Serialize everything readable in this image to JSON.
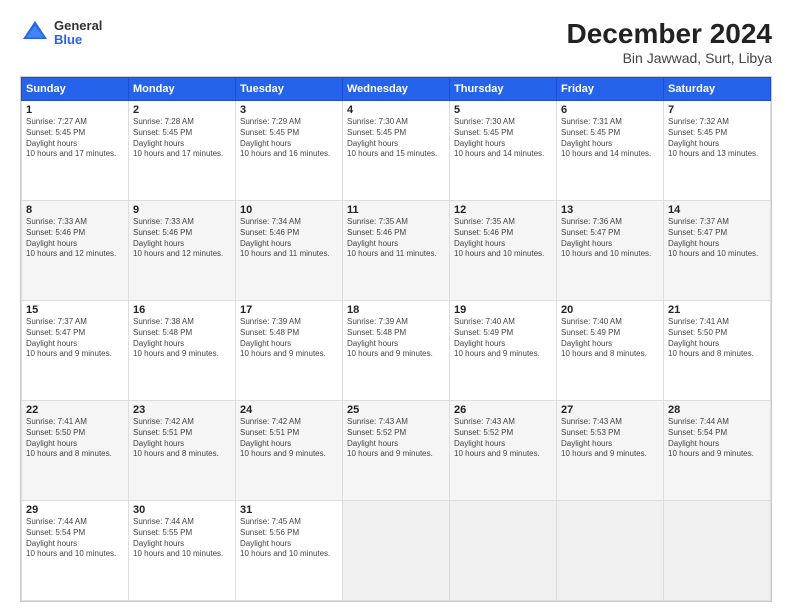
{
  "header": {
    "logo": {
      "line1": "General",
      "line2": "Blue"
    },
    "title": "December 2024",
    "subtitle": "Bin Jawwad, Surt, Libya"
  },
  "calendar": {
    "days_of_week": [
      "Sunday",
      "Monday",
      "Tuesday",
      "Wednesday",
      "Thursday",
      "Friday",
      "Saturday"
    ],
    "weeks": [
      [
        null,
        {
          "day": 2,
          "rise": "7:28 AM",
          "set": "5:45 PM",
          "daylight": "10 hours and 17 minutes."
        },
        {
          "day": 3,
          "rise": "7:29 AM",
          "set": "5:45 PM",
          "daylight": "10 hours and 16 minutes."
        },
        {
          "day": 4,
          "rise": "7:30 AM",
          "set": "5:45 PM",
          "daylight": "10 hours and 15 minutes."
        },
        {
          "day": 5,
          "rise": "7:30 AM",
          "set": "5:45 PM",
          "daylight": "10 hours and 14 minutes."
        },
        {
          "day": 6,
          "rise": "7:31 AM",
          "set": "5:45 PM",
          "daylight": "10 hours and 14 minutes."
        },
        {
          "day": 7,
          "rise": "7:32 AM",
          "set": "5:45 PM",
          "daylight": "10 hours and 13 minutes."
        }
      ],
      [
        {
          "day": 8,
          "rise": "7:33 AM",
          "set": "5:46 PM",
          "daylight": "10 hours and 12 minutes."
        },
        {
          "day": 9,
          "rise": "7:33 AM",
          "set": "5:46 PM",
          "daylight": "10 hours and 12 minutes."
        },
        {
          "day": 10,
          "rise": "7:34 AM",
          "set": "5:46 PM",
          "daylight": "10 hours and 11 minutes."
        },
        {
          "day": 11,
          "rise": "7:35 AM",
          "set": "5:46 PM",
          "daylight": "10 hours and 11 minutes."
        },
        {
          "day": 12,
          "rise": "7:35 AM",
          "set": "5:46 PM",
          "daylight": "10 hours and 10 minutes."
        },
        {
          "day": 13,
          "rise": "7:36 AM",
          "set": "5:47 PM",
          "daylight": "10 hours and 10 minutes."
        },
        {
          "day": 14,
          "rise": "7:37 AM",
          "set": "5:47 PM",
          "daylight": "10 hours and 10 minutes."
        }
      ],
      [
        {
          "day": 15,
          "rise": "7:37 AM",
          "set": "5:47 PM",
          "daylight": "10 hours and 9 minutes."
        },
        {
          "day": 16,
          "rise": "7:38 AM",
          "set": "5:48 PM",
          "daylight": "10 hours and 9 minutes."
        },
        {
          "day": 17,
          "rise": "7:39 AM",
          "set": "5:48 PM",
          "daylight": "10 hours and 9 minutes."
        },
        {
          "day": 18,
          "rise": "7:39 AM",
          "set": "5:48 PM",
          "daylight": "10 hours and 9 minutes."
        },
        {
          "day": 19,
          "rise": "7:40 AM",
          "set": "5:49 PM",
          "daylight": "10 hours and 9 minutes."
        },
        {
          "day": 20,
          "rise": "7:40 AM",
          "set": "5:49 PM",
          "daylight": "10 hours and 8 minutes."
        },
        {
          "day": 21,
          "rise": "7:41 AM",
          "set": "5:50 PM",
          "daylight": "10 hours and 8 minutes."
        }
      ],
      [
        {
          "day": 22,
          "rise": "7:41 AM",
          "set": "5:50 PM",
          "daylight": "10 hours and 8 minutes."
        },
        {
          "day": 23,
          "rise": "7:42 AM",
          "set": "5:51 PM",
          "daylight": "10 hours and 8 minutes."
        },
        {
          "day": 24,
          "rise": "7:42 AM",
          "set": "5:51 PM",
          "daylight": "10 hours and 9 minutes."
        },
        {
          "day": 25,
          "rise": "7:43 AM",
          "set": "5:52 PM",
          "daylight": "10 hours and 9 minutes."
        },
        {
          "day": 26,
          "rise": "7:43 AM",
          "set": "5:52 PM",
          "daylight": "10 hours and 9 minutes."
        },
        {
          "day": 27,
          "rise": "7:43 AM",
          "set": "5:53 PM",
          "daylight": "10 hours and 9 minutes."
        },
        {
          "day": 28,
          "rise": "7:44 AM",
          "set": "5:54 PM",
          "daylight": "10 hours and 9 minutes."
        }
      ],
      [
        {
          "day": 29,
          "rise": "7:44 AM",
          "set": "5:54 PM",
          "daylight": "10 hours and 10 minutes."
        },
        {
          "day": 30,
          "rise": "7:44 AM",
          "set": "5:55 PM",
          "daylight": "10 hours and 10 minutes."
        },
        {
          "day": 31,
          "rise": "7:45 AM",
          "set": "5:56 PM",
          "daylight": "10 hours and 10 minutes."
        },
        null,
        null,
        null,
        null
      ]
    ],
    "week0_day1": {
      "day": 1,
      "rise": "7:27 AM",
      "set": "5:45 PM",
      "daylight": "10 hours and 17 minutes."
    }
  }
}
